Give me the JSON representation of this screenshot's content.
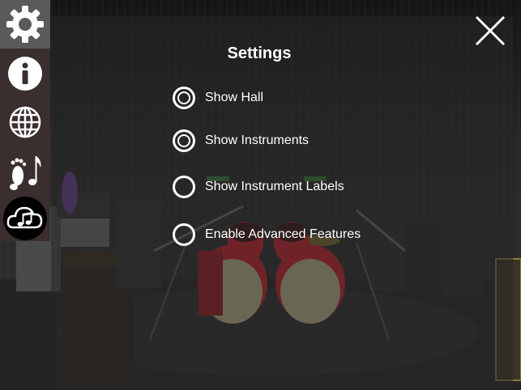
{
  "settings": {
    "title": "Settings",
    "options": [
      {
        "label": "Show Hall",
        "checked": true
      },
      {
        "label": "Show Instruments",
        "checked": true
      },
      {
        "label": "Show Instrument Labels",
        "checked": false
      },
      {
        "label": "Enable Advanced Features",
        "checked": false
      }
    ]
  },
  "sidebar": {
    "items": [
      {
        "icon": "gear-icon",
        "active": true
      },
      {
        "icon": "info-icon",
        "active": false
      },
      {
        "icon": "globe-icon",
        "active": false
      },
      {
        "icon": "footprint-music-note-icon",
        "active": false
      },
      {
        "icon": "cloud-music-icon",
        "active": false
      }
    ]
  },
  "close": {
    "icon": "close-icon"
  },
  "colors": {
    "drum_red": "#c8202a",
    "sidebar_bg": "#3b2e2e",
    "active_item_bg": "#5a5a5a",
    "text": "#ffffff"
  }
}
